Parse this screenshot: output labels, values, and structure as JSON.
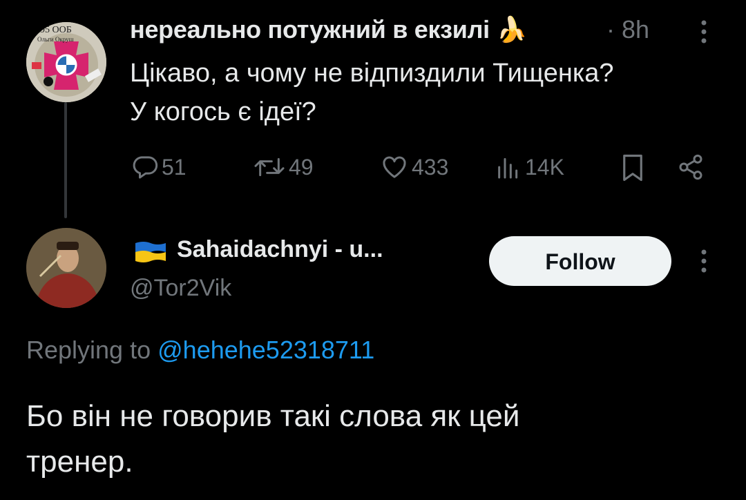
{
  "tweet1": {
    "author_name": "нереально потужний в екзилі",
    "emoji": "🍌",
    "separator": "·",
    "time": "8h",
    "text_line1": "Цікаво, а чому не відпиздили Тищенка?",
    "text_line2": "У когось є ідеї?",
    "avatar_text_top": "95 ООБ",
    "avatar_text_sub": "Ольги Окруш",
    "actions": {
      "replies": "51",
      "retweets": "49",
      "likes": "433",
      "views": "14K"
    }
  },
  "tweet2": {
    "author_name": "Sahaidachnyi - u...",
    "handle": "@Tor2Vik",
    "follow_label": "Follow",
    "replying_prefix": "Replying to",
    "replying_to": "@hehehe52318711",
    "text_line1": "Бо він не говорив такі слова як цей",
    "text_line2": "тренер."
  },
  "colors": {
    "background": "#000000",
    "text": "#e7e9ea",
    "muted": "#71767b",
    "link": "#1d9bf0",
    "follow_bg": "#eff3f4"
  }
}
